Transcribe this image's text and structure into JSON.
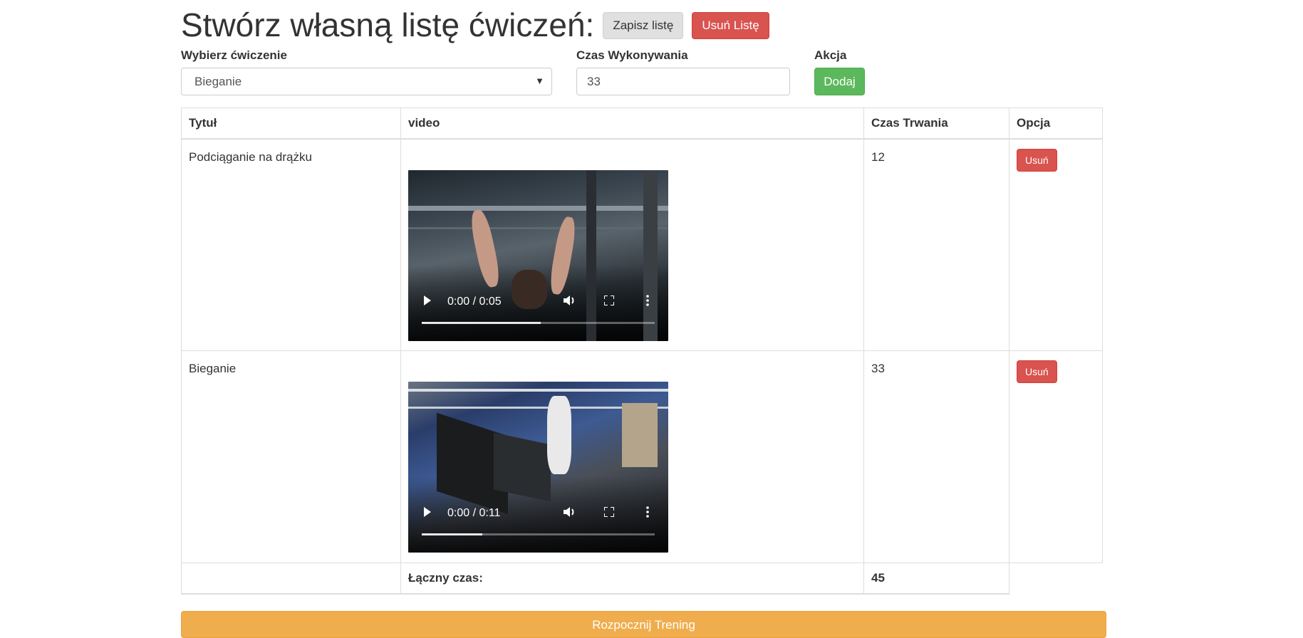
{
  "header": {
    "title": "Stwórz własną listę ćwiczeń:",
    "save_label": "Zapisz listę",
    "delete_list_label": "Usuń Listę"
  },
  "form": {
    "exercise_label": "Wybierz ćwiczenie",
    "exercise_selected": "Bieganie",
    "duration_label": "Czas Wykonywania",
    "duration_value": "33",
    "action_label": "Akcja",
    "add_label": "Dodaj"
  },
  "table": {
    "headers": [
      "Tytuł",
      "video",
      "Czas Trwania",
      "Opcja"
    ],
    "rows": [
      {
        "title": "Podciąganie na drążku",
        "video_time": "0:00 / 0:05",
        "video_progress": 0.51,
        "duration": "12",
        "remove_label": "Usuń"
      },
      {
        "title": "Bieganie",
        "video_time": "0:00 / 0:11",
        "video_progress": 0.26,
        "duration": "33",
        "remove_label": "Usuń"
      }
    ],
    "total_label": "Łączny czas:",
    "total_value": "45"
  },
  "start_label": "Rozpocznij Trening",
  "icons": [
    "play-icon",
    "volume-icon",
    "fullscreen-icon",
    "more-options-icon",
    "dropdown-caret-icon"
  ],
  "colors": {
    "danger": "#d9534f",
    "success": "#5cb85c",
    "warning": "#f0ad4e",
    "default": "#e0e0e0"
  }
}
